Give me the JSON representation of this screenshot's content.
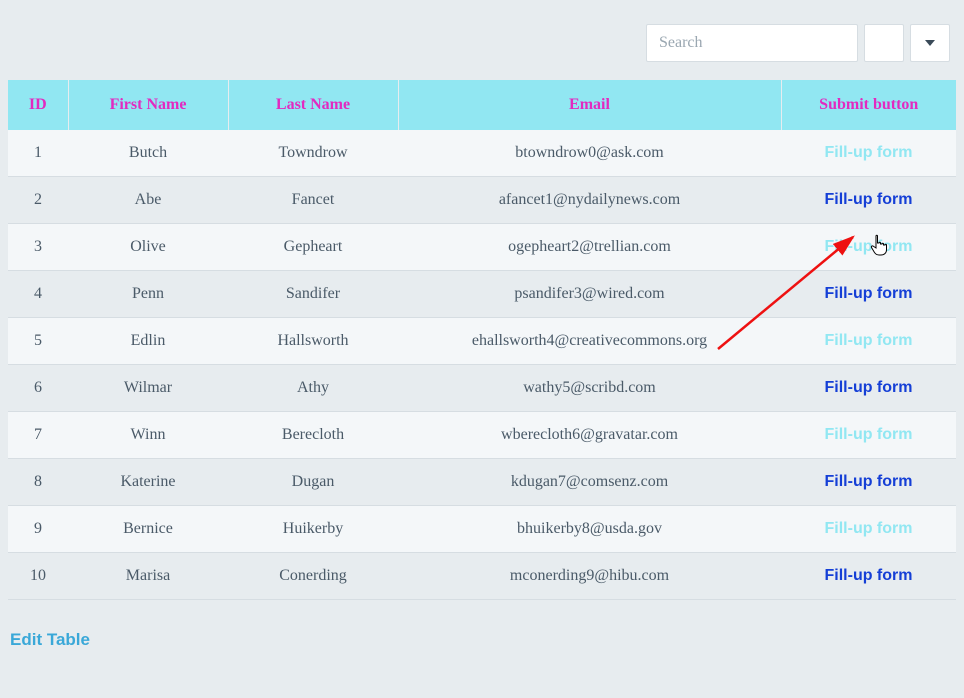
{
  "toolbar": {
    "search_placeholder": "Search"
  },
  "columns": {
    "id": "ID",
    "first_name": "First Name",
    "last_name": "Last Name",
    "email": "Email",
    "submit": "Submit button"
  },
  "link_label": "Fill-up form",
  "rows": [
    {
      "id": "1",
      "first": "Butch",
      "last": "Towndrow",
      "email": "btowndrow0@ask.com"
    },
    {
      "id": "2",
      "first": "Abe",
      "last": "Fancet",
      "email": "afancet1@nydailynews.com"
    },
    {
      "id": "3",
      "first": "Olive",
      "last": "Gepheart",
      "email": "ogepheart2@trellian.com"
    },
    {
      "id": "4",
      "first": "Penn",
      "last": "Sandifer",
      "email": "psandifer3@wired.com"
    },
    {
      "id": "5",
      "first": "Edlin",
      "last": "Hallsworth",
      "email": "ehallsworth4@creativecommons.org"
    },
    {
      "id": "6",
      "first": "Wilmar",
      "last": "Athy",
      "email": "wathy5@scribd.com"
    },
    {
      "id": "7",
      "first": "Winn",
      "last": "Berecloth",
      "email": "wberecloth6@gravatar.com"
    },
    {
      "id": "8",
      "first": "Katerine",
      "last": "Dugan",
      "email": "kdugan7@comsenz.com"
    },
    {
      "id": "9",
      "first": "Bernice",
      "last": "Huikerby",
      "email": "bhuikerby8@usda.gov"
    },
    {
      "id": "10",
      "first": "Marisa",
      "last": "Conerding",
      "email": "mconerding9@hibu.com"
    }
  ],
  "footer": {
    "edit_label": "Edit Table"
  }
}
